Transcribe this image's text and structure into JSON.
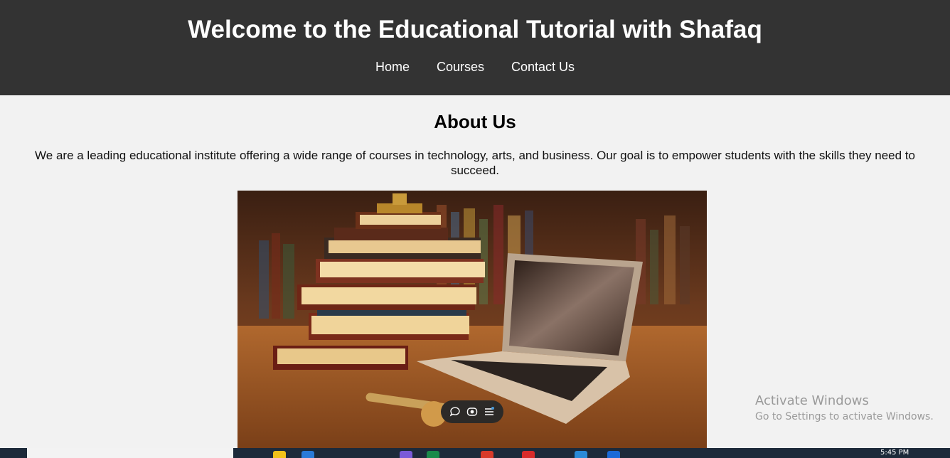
{
  "header": {
    "title": "Welcome to the Educational Tutorial with Shafaq",
    "nav": [
      {
        "label": "Home"
      },
      {
        "label": "Courses"
      },
      {
        "label": "Contact Us"
      }
    ]
  },
  "about": {
    "title": "About Us",
    "text": "We are a leading educational institute offering a wide range of courses in technology, arts, and business. Our goal is to empower students with the skills they need to succeed."
  },
  "image_toolbar": {
    "icons": [
      "comment-icon",
      "lens-icon",
      "menu-icon"
    ]
  },
  "watermark": {
    "title": "Activate Windows",
    "subtitle": "Go to Settings to activate Windows."
  },
  "taskbar": {
    "time": "5:45 PM"
  },
  "colors": {
    "header_bg": "#333333",
    "page_bg": "#f2f2f2",
    "taskbar_bg": "#1d2a3a"
  }
}
